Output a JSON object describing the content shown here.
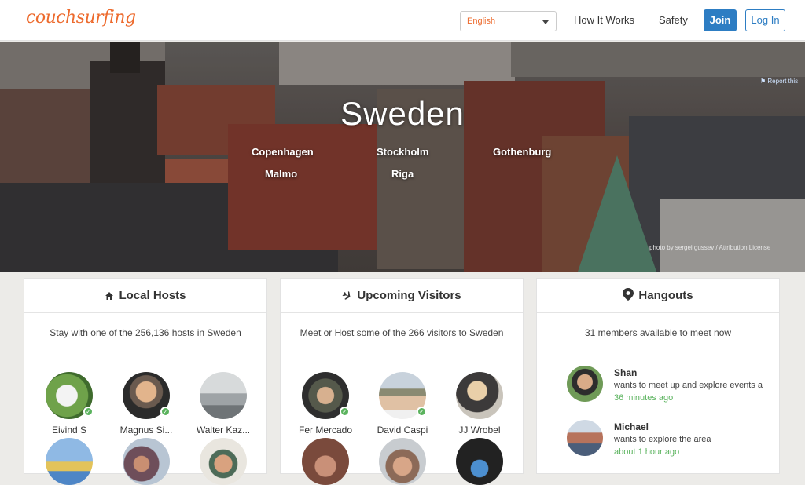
{
  "header": {
    "logo": "couchsurfing",
    "language": "English",
    "nav": {
      "how_it_works": "How It Works",
      "safety": "Safety"
    },
    "join": "Join",
    "login": "Log In"
  },
  "hero": {
    "title": "Sweden",
    "cities": [
      "Copenhagen",
      "Stockholm",
      "Gothenburg",
      "Malmo",
      "Riga"
    ],
    "report": "Report this",
    "credit": "photo by sergei gussev / Attribution License"
  },
  "cards": {
    "local_hosts": {
      "title": "Local Hosts",
      "subtitle": "Stay with one of the 256,136 hosts in Sweden",
      "people": [
        {
          "name": "Eivind S",
          "verified": true
        },
        {
          "name": "Magnus Si...",
          "verified": true
        },
        {
          "name": "Walter Kaz...",
          "verified": false
        }
      ]
    },
    "upcoming_visitors": {
      "title": "Upcoming Visitors",
      "subtitle": "Meet or Host some of the 266 visitors to Sweden",
      "people": [
        {
          "name": "Fer Mercado",
          "verified": true
        },
        {
          "name": "David Caspi",
          "verified": true
        },
        {
          "name": "JJ Wrobel",
          "verified": false
        }
      ]
    },
    "hangouts": {
      "title": "Hangouts",
      "subtitle": "31 members available to meet now",
      "members": [
        {
          "name": "Shan",
          "desc": "wants to meet up and explore events a",
          "time": "36 minutes ago"
        },
        {
          "name": "Michael",
          "desc": "wants to explore the area",
          "time": "about 1 hour ago"
        }
      ]
    }
  },
  "colors": {
    "brand": "#ed6b2e",
    "primary": "#2d7dc3",
    "online": "#5bb35e"
  }
}
